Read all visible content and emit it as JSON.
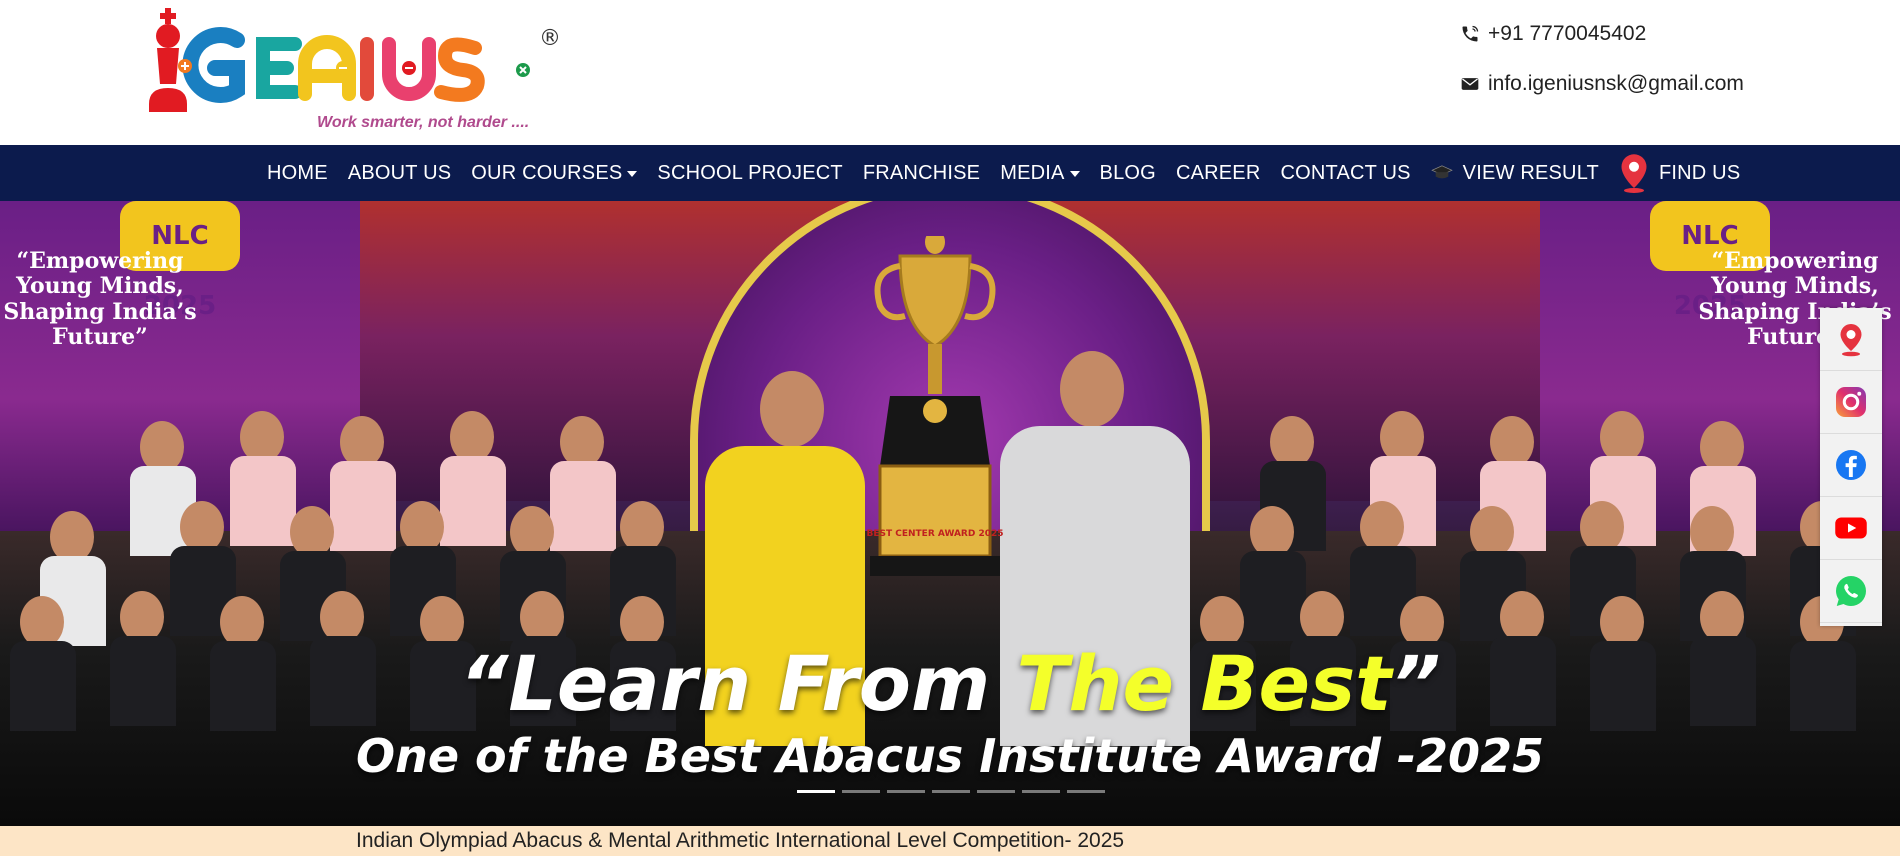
{
  "brand": {
    "logo_text": "iGENIUS",
    "registered_mark": "®",
    "tagline": "Work smarter, not harder ...."
  },
  "contact": {
    "phone": "+91 7770045402",
    "email": "info.igeniusnsk@gmail.com",
    "phone_icon": "phone-icon",
    "email_icon": "envelope-icon"
  },
  "nav": {
    "items": [
      {
        "label": "HOME",
        "dropdown": false
      },
      {
        "label": "ABOUT US",
        "dropdown": false
      },
      {
        "label": "OUR COURSES",
        "dropdown": true
      },
      {
        "label": "SCHOOL PROJECT",
        "dropdown": false
      },
      {
        "label": "FRANCHISE",
        "dropdown": false
      },
      {
        "label": "MEDIA",
        "dropdown": true
      },
      {
        "label": "BLOG",
        "dropdown": false
      },
      {
        "label": "CAREER",
        "dropdown": false
      },
      {
        "label": "CONTACT US",
        "dropdown": false
      },
      {
        "label": "VIEW RESULT",
        "icon": "graduation-cap-icon"
      },
      {
        "label": "FIND US",
        "icon": "map-pin-icon"
      }
    ]
  },
  "hero": {
    "banner_left": "“Empowering Young Minds, Shaping India’s Future”",
    "banner_right": "“Empowering Young Minds, Shaping India’s Future”",
    "badge": "NLC 2025",
    "plaque": "BEST CENTER AWARD 2025",
    "headline_quote_open": "“",
    "headline_part1": "Learn From ",
    "headline_highlight": "The Best",
    "headline_quote_close": "”",
    "subheadline": "One of the Best Abacus Institute Award -2025",
    "slides_count": 7,
    "active_slide": 1
  },
  "social": {
    "items": [
      "location-icon",
      "instagram-icon",
      "facebook-icon",
      "youtube-icon",
      "whatsapp-icon"
    ]
  },
  "ticker": {
    "text": "Indian Olympiad Abacus & Mental Arithmetic International Level Competition- 2025"
  },
  "colors": {
    "nav_bg": "#0c1b4d",
    "highlight": "#f4ff2a",
    "ticker_bg": "#fde5c6"
  }
}
